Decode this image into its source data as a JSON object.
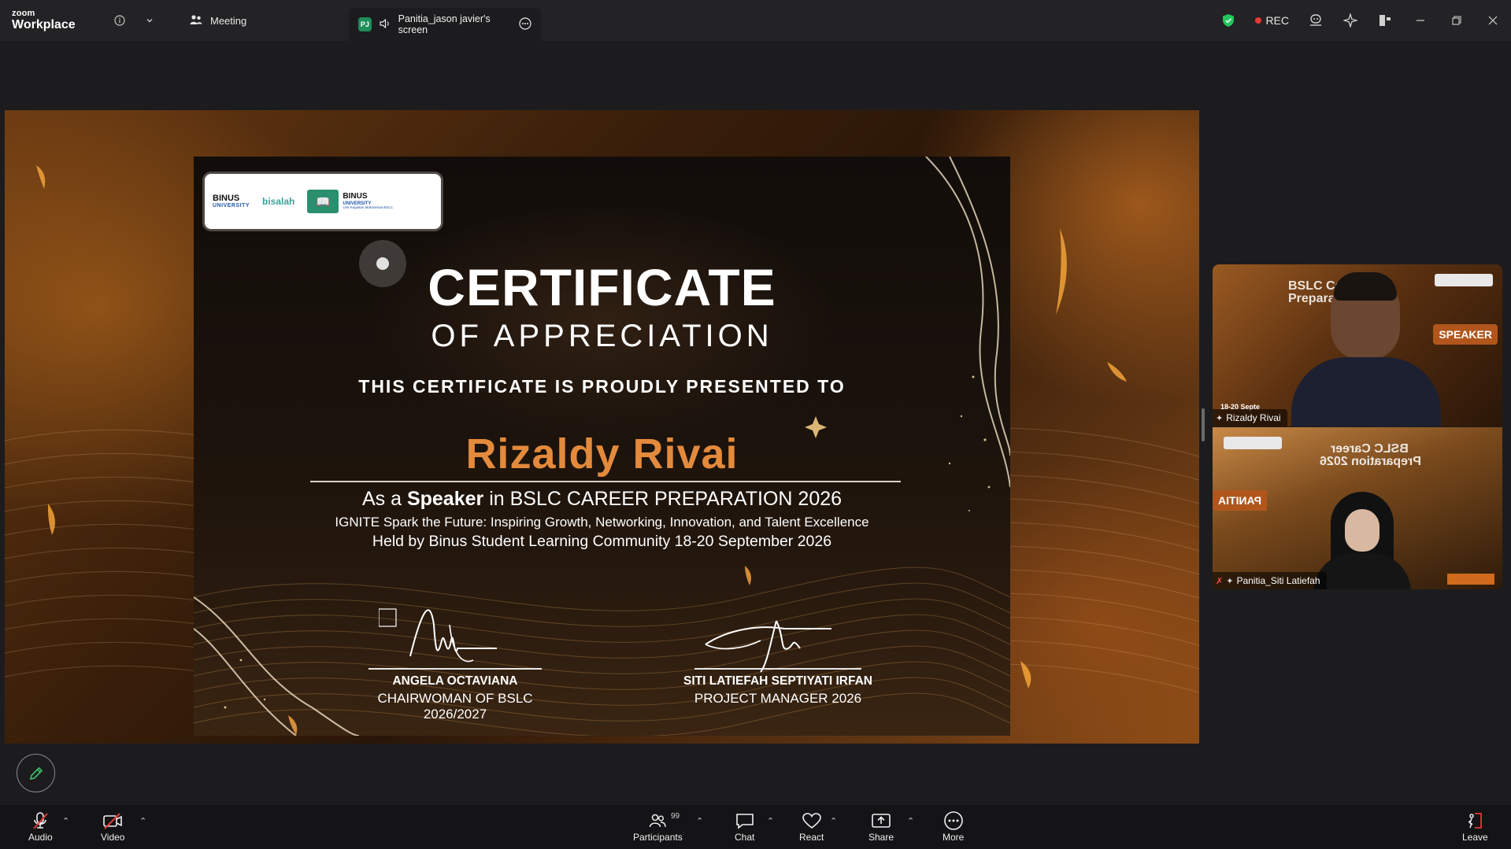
{
  "titlebar": {
    "logo_small": "zoom",
    "logo_big": "Workplace",
    "meeting_tab": "Meeting",
    "share_tab": "Panitia_jason javier's screen",
    "share_badge": "PJ",
    "rec_label": "REC"
  },
  "certificate": {
    "logo1_top": "BINUS",
    "logo1_bottom": "UNIVERSITY",
    "logo2": "bisalah",
    "logo3_t1": "BINUS",
    "logo3_t2": "UNIVERSITY",
    "logo3_t3": "Unit Kegiatan Mahasiswa BSLC",
    "title": "CERTIFICATE",
    "subtitle": "OF APPRECIATION",
    "presented": "THIS CERTIFICATE IS PROUDLY PRESENTED TO",
    "recipient": "Rizaldy Rivai",
    "role_prefix": "As a",
    "role": "Speaker",
    "role_suffix": "in BSLC CAREER PREPARATION 2026",
    "event_line": "IGNITE Spark the Future: Inspiring Growth, Networking, Innovation, and Talent Excellence",
    "held_line": "Held by Binus Student Learning Community 18-20 September 2026",
    "signatory1_name": "ANGELA OCTAVIANA",
    "signatory1_title": "CHAIRWOMAN OF BSLC 2026/2027",
    "signatory2_name": "SITI LATIEFAH SEPTIYATI IRFAN",
    "signatory2_title": "PROJECT MANAGER 2026"
  },
  "gallery": {
    "tile1": {
      "bg_line1": "BSLC Career",
      "bg_line2": "Preparation 2026",
      "badge": "SPEAKER",
      "date_snippet": "18-20 Septe",
      "name": "Rizaldy Rivai"
    },
    "tile2": {
      "bg_line1": "BSLC Career",
      "bg_line2": "Preparation 2026",
      "badge": "PANITIA",
      "name": "Panitia_Siti Latiefah"
    }
  },
  "toolbar": {
    "audio": "Audio",
    "video": "Video",
    "participants": "Participants",
    "participants_count": "99",
    "chat": "Chat",
    "react": "React",
    "share": "Share",
    "more": "More",
    "leave": "Leave"
  },
  "colors": {
    "accent_green": "#1e8e5a",
    "rec_red": "#e53935",
    "recipient_orange": "#e38a3c",
    "leave_red": "#e53935"
  }
}
